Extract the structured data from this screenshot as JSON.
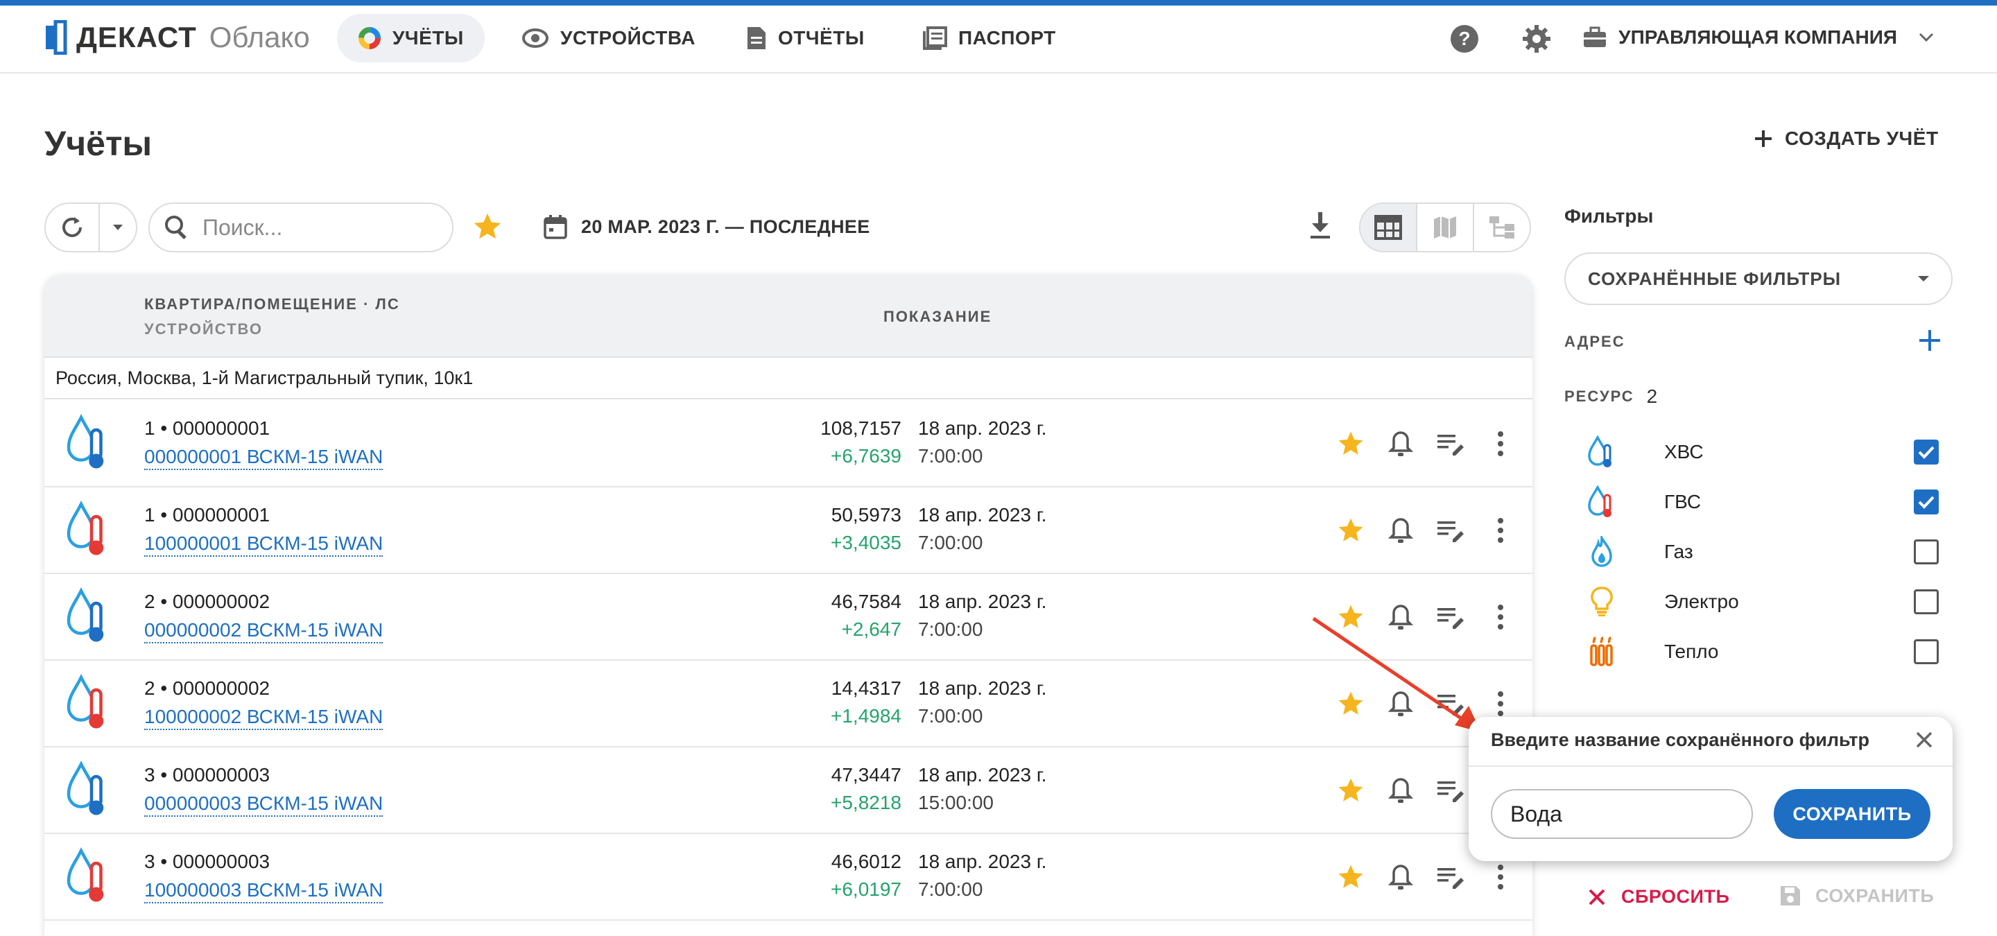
{
  "header": {
    "logo_brand": "ДЕКАСТ",
    "logo_sub": "Облако",
    "nav": [
      {
        "label": "УЧЁТЫ",
        "icon": "accounting-pie-icon",
        "active": true
      },
      {
        "label": "УСТРОЙСТВА",
        "icon": "device-icon",
        "active": false
      },
      {
        "label": "ОТЧЁТЫ",
        "icon": "report-icon",
        "active": false
      },
      {
        "label": "ПАСПОРТ",
        "icon": "passport-icon",
        "active": false
      }
    ],
    "company": "УПРАВЛЯЮЩАЯ КОМПАНИЯ"
  },
  "page": {
    "title": "Учёты",
    "create_label": "СОЗДАТЬ УЧЁТ"
  },
  "toolbar": {
    "search_placeholder": "Поиск...",
    "date_range": "20 МАР. 2023 Г. — ПОСЛЕДНЕЕ"
  },
  "table": {
    "col1_line1": "КВАРТИРА/ПОМЕЩЕНИЕ · ЛС",
    "col1_line2": "УСТРОЙСТВО",
    "col2": "ПОКАЗАНИЕ",
    "group": "Россия, Москва, 1-й Магистральный тупик, 10к1",
    "rows": [
      {
        "resource": "cold",
        "account": "1 • 000000001",
        "device": "000000001 ВСКМ-15 iWAN",
        "value": "108,7157",
        "delta": "+6,7639",
        "date": "18 апр. 2023 г.",
        "time": "7:00:00"
      },
      {
        "resource": "hot",
        "account": "1 • 000000001",
        "device": "100000001 ВСКМ-15 iWAN",
        "value": "50,5973",
        "delta": "+3,4035",
        "date": "18 апр. 2023 г.",
        "time": "7:00:00"
      },
      {
        "resource": "cold",
        "account": "2 • 000000002",
        "device": "000000002 ВСКМ-15 iWAN",
        "value": "46,7584",
        "delta": "+2,647",
        "date": "18 апр. 2023 г.",
        "time": "7:00:00"
      },
      {
        "resource": "hot",
        "account": "2 • 000000002",
        "device": "100000002 ВСКМ-15 iWAN",
        "value": "14,4317",
        "delta": "+1,4984",
        "date": "18 апр. 2023 г.",
        "time": "7:00:00"
      },
      {
        "resource": "cold",
        "account": "3 • 000000003",
        "device": "000000003 ВСКМ-15 iWAN",
        "value": "47,3447",
        "delta": "+5,8218",
        "date": "18 апр. 2023 г.",
        "time": "15:00:00"
      },
      {
        "resource": "hot",
        "account": "3 • 000000003",
        "device": "100000003 ВСКМ-15 iWAN",
        "value": "46,6012",
        "delta": "+6,0197",
        "date": "18 апр. 2023 г.",
        "time": "7:00:00"
      }
    ]
  },
  "filters": {
    "title": "Фильтры",
    "saved_label": "СОХРАНЁННЫЕ ФИЛЬТРЫ",
    "address_label": "АДРЕС",
    "resource_label": "РЕСУРС",
    "resource_count": "2",
    "resources": [
      {
        "label": "ХВС",
        "checked": true,
        "icon": "cold-water-icon"
      },
      {
        "label": "ГВС",
        "checked": true,
        "icon": "hot-water-icon"
      },
      {
        "label": "Газ",
        "checked": false,
        "icon": "gas-flame-icon"
      },
      {
        "label": "Электро",
        "checked": false,
        "icon": "light-bulb-icon"
      },
      {
        "label": "Тепло",
        "checked": false,
        "icon": "radiator-icon"
      }
    ],
    "reset_label": "СБРОСИТЬ",
    "save_label": "СОХРАНИТЬ"
  },
  "popup": {
    "title": "Введите название сохранённого фильтр",
    "input_value": "Вода",
    "save_label": "СОХРАНИТЬ"
  },
  "colors": {
    "accent": "#1e6fc4",
    "positive": "#25a36b",
    "danger": "#d81b4a",
    "star": "#f6b51e",
    "annotation_arrow": "#e8402a"
  }
}
